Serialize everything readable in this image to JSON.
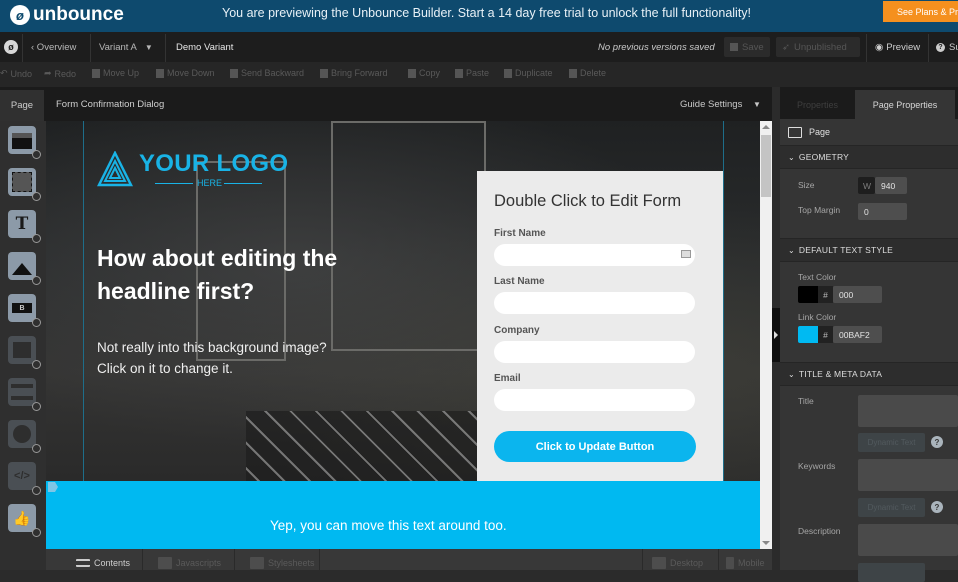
{
  "banner": {
    "brand": "unbounce",
    "message": "You are previewing the Unbounce Builder. Start a 14 day free trial to unlock the full functionality!",
    "cta_label": "See Plans & Pricing"
  },
  "topnav": {
    "overview_label": "‹ Overview",
    "variant_label": "Variant A",
    "variant_name": "Demo Variant",
    "versions_status": "No previous versions saved",
    "save_label": "Save",
    "publish_label": "Unpublished",
    "preview_label": "Preview",
    "support_label": "Support"
  },
  "toolbar": {
    "items": [
      "Undo",
      "Redo",
      "Move Up",
      "Move Down",
      "Send Backward",
      "Bring Forward",
      "Copy",
      "Paste",
      "Duplicate",
      "Delete"
    ]
  },
  "pagebar": {
    "page_tab": "Page",
    "title": "Form Confirmation Dialog",
    "guide_settings": "Guide Settings"
  },
  "sidebar": {
    "tools": [
      {
        "name": "section",
        "enabled": true
      },
      {
        "name": "box",
        "enabled": true
      },
      {
        "name": "text",
        "enabled": true,
        "glyph": "T"
      },
      {
        "name": "image",
        "enabled": true
      },
      {
        "name": "button",
        "enabled": true,
        "glyph": "B"
      },
      {
        "name": "form",
        "enabled": false
      },
      {
        "name": "list",
        "enabled": false
      },
      {
        "name": "video",
        "enabled": false
      },
      {
        "name": "custom-html",
        "enabled": false,
        "glyph": "</>"
      },
      {
        "name": "social",
        "enabled": true
      }
    ]
  },
  "canvas": {
    "logo_text": "YOUR LOGO",
    "logo_sub": "HERE",
    "headline": "How about editing the headline first?",
    "subtext": "Not really into this background image? Click on it to change it.",
    "form": {
      "title": "Double Click to Edit Form",
      "fields": [
        "First Name",
        "Last Name",
        "Company",
        "Email"
      ],
      "button_label": "Click to Update Button"
    },
    "footer_text": "Yep, you can move this text around too.",
    "accent": "#00B9F1"
  },
  "bottombar": {
    "tabs": [
      "Contents",
      "Javascripts",
      "Stylesheets"
    ],
    "views": [
      "Desktop",
      "Mobile"
    ]
  },
  "rpanel": {
    "tabs": [
      "Properties",
      "Page Properties"
    ],
    "page_label": "Page",
    "geometry": {
      "heading": "GEOMETRY",
      "size_label": "Size",
      "width_prefix": "W",
      "width_value": "940",
      "top_margin_label": "Top Margin",
      "top_margin_value": "0"
    },
    "text_style": {
      "heading": "DEFAULT TEXT STYLE",
      "text_color_label": "Text Color",
      "text_color_value": "000",
      "text_color_swatch": "#000000",
      "link_color_label": "Link Color",
      "link_color_value": "00BAF2",
      "link_color_swatch": "#00BAF2"
    },
    "meta": {
      "heading": "TITLE & META DATA",
      "title_label": "Title",
      "keywords_label": "Keywords",
      "description_label": "Description",
      "dynamic_text": "Dynamic Text",
      "help": "?"
    }
  }
}
